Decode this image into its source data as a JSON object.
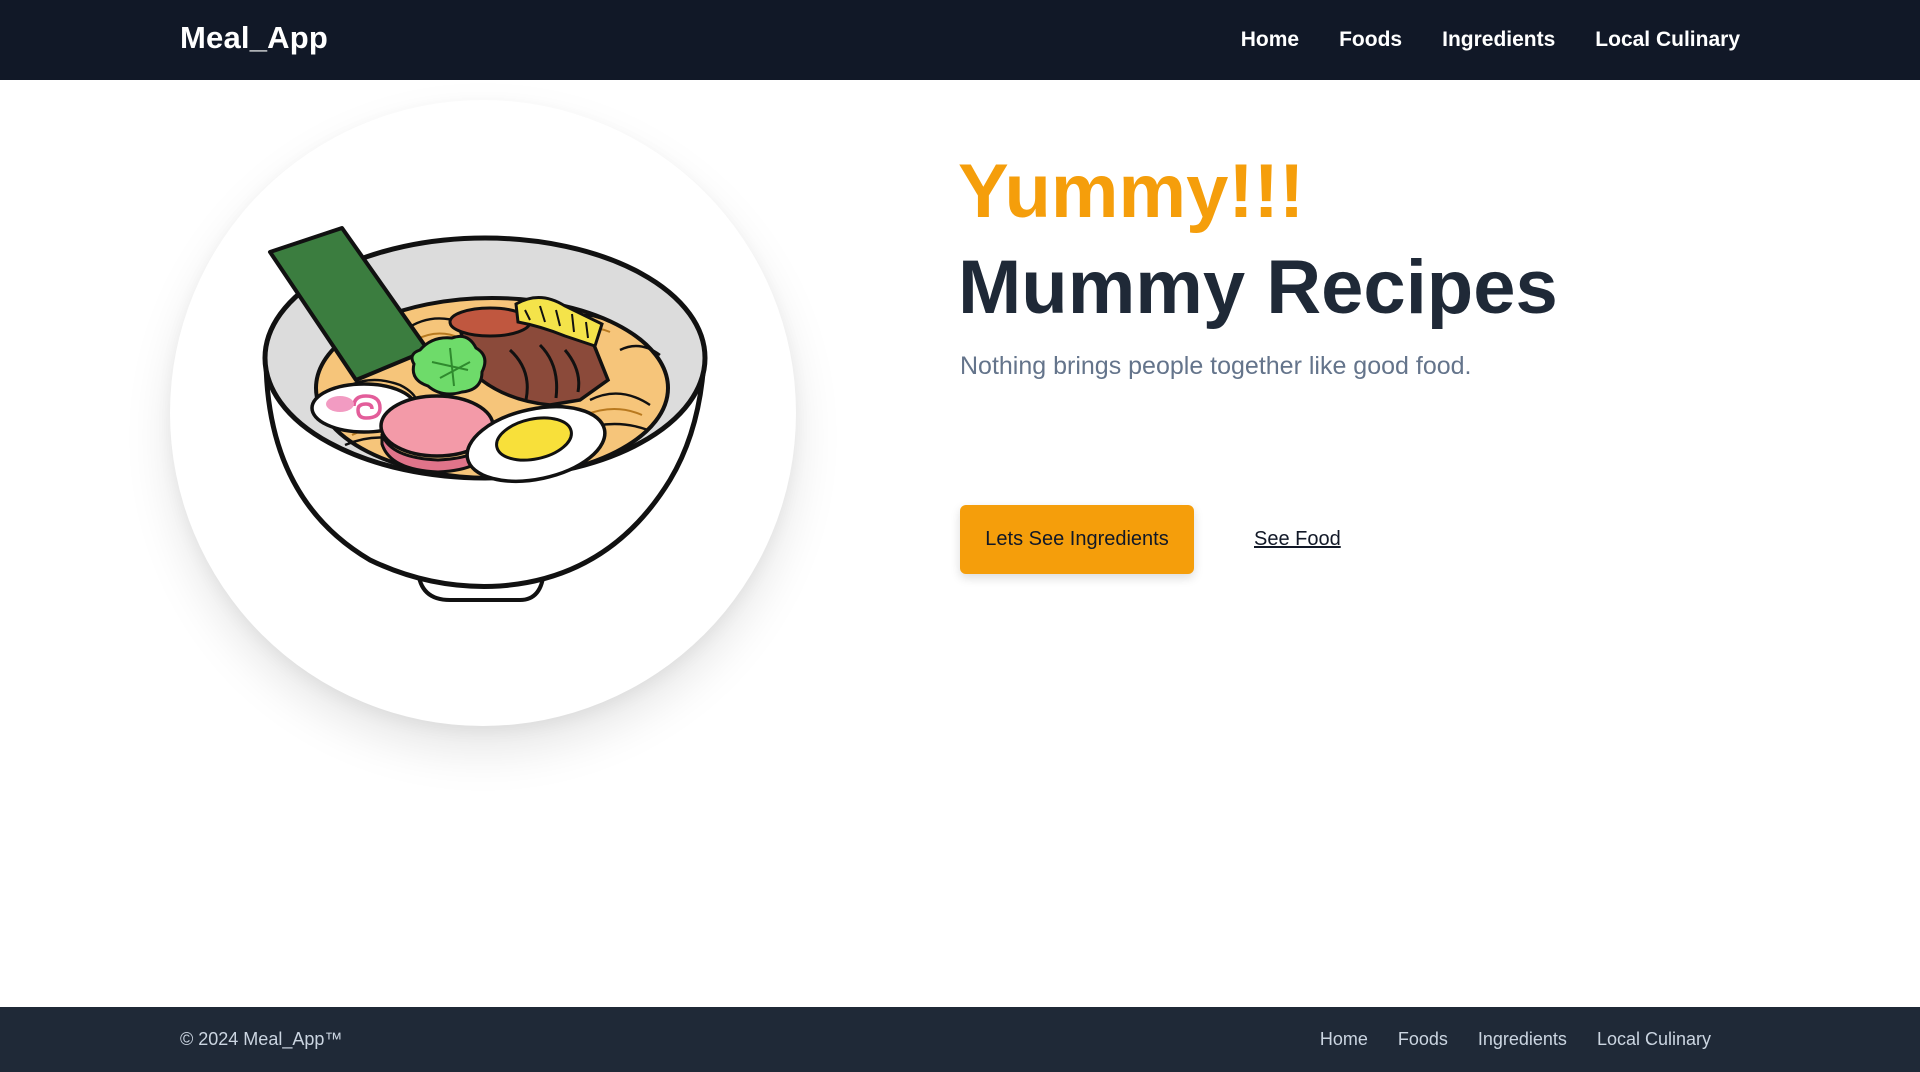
{
  "header": {
    "brand": "Meal_App",
    "nav": [
      "Home",
      "Foods",
      "Ingredients",
      "Local Culinary"
    ]
  },
  "hero": {
    "title_line1": "Yummy!!!",
    "title_line2": "Mummy Recipes",
    "subtitle": "Nothing brings people together like good food.",
    "primary_button": "Lets See Ingredients",
    "secondary_link": "See Food",
    "illustration": "ramen-bowl-illustration"
  },
  "footer": {
    "copyright": "© 2024 Meal_App™",
    "nav": [
      "Home",
      "Foods",
      "Ingredients",
      "Local Culinary"
    ]
  },
  "colors": {
    "header_bg": "#111827",
    "footer_bg": "#1f2937",
    "accent": "#f59e0b",
    "title_dark": "#1f2937",
    "subtitle": "#64748b"
  }
}
